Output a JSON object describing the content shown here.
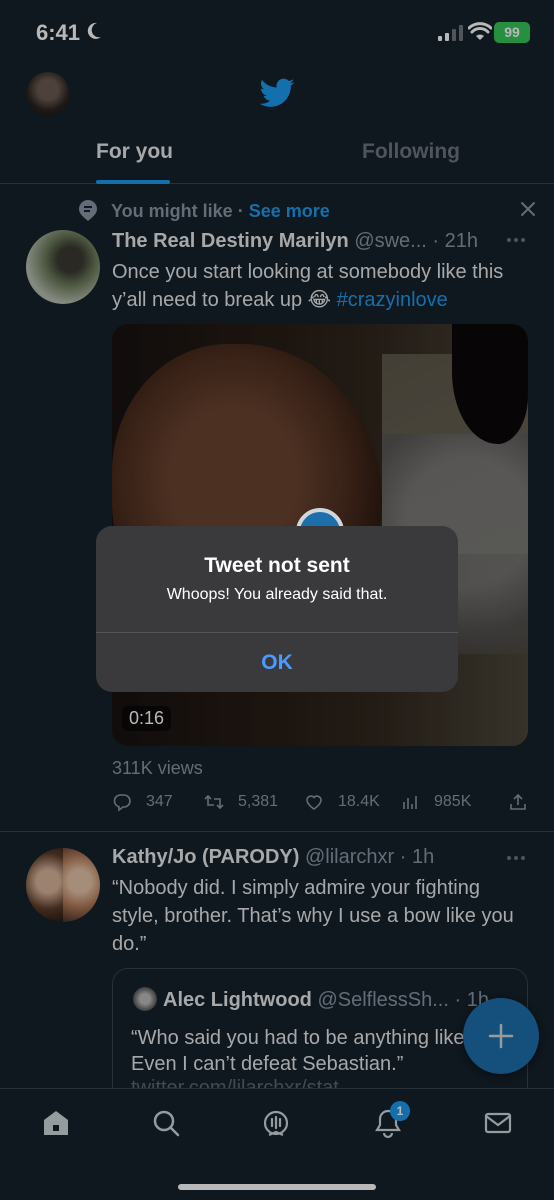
{
  "status_bar": {
    "time": "6:41",
    "battery": "99"
  },
  "header": {
    "tabs": [
      {
        "label": "For you"
      },
      {
        "label": "Following"
      }
    ]
  },
  "tweet1": {
    "context_label": "You might like",
    "context_separator": "·",
    "context_link": "See more",
    "name": "The Real Destiny Marilyn",
    "handle": "@swe...",
    "time_sep": "·",
    "time": "21h",
    "body_text": "Once you start looking at somebody like this y’all need to break up 😂 ",
    "hashtag": "#crazyinlove",
    "video_duration": "0:16",
    "views_label": "311K views",
    "replies": "347",
    "retweets": "5,381",
    "likes": "18.4K",
    "view_count": "985K"
  },
  "tweet2": {
    "name": "Kathy/Jo (PARODY)",
    "handle": "@lilarchxr",
    "time_sep": "·",
    "time": "1h",
    "body": "“Nobody did. I simply admire your fighting style, brother. That’s why I use a bow like you do.”",
    "quote": {
      "name": "Alec Lightwood",
      "handle": "@SelflessSh...",
      "time_sep": "·",
      "time": "1h",
      "body": "“Who said you had to be anything like me? Even I can’t defeat Sebastian.”",
      "link": "twitter.com/lilarchxr/stat..."
    }
  },
  "bottom_nav": {
    "notification_badge": "1"
  },
  "alert": {
    "title": "Tweet not sent",
    "message": "Whoops! You already said that.",
    "ok_label": "OK"
  },
  "colors": {
    "accent": "#1d9bf0",
    "background": "#15202b",
    "battery": "#35c759"
  }
}
